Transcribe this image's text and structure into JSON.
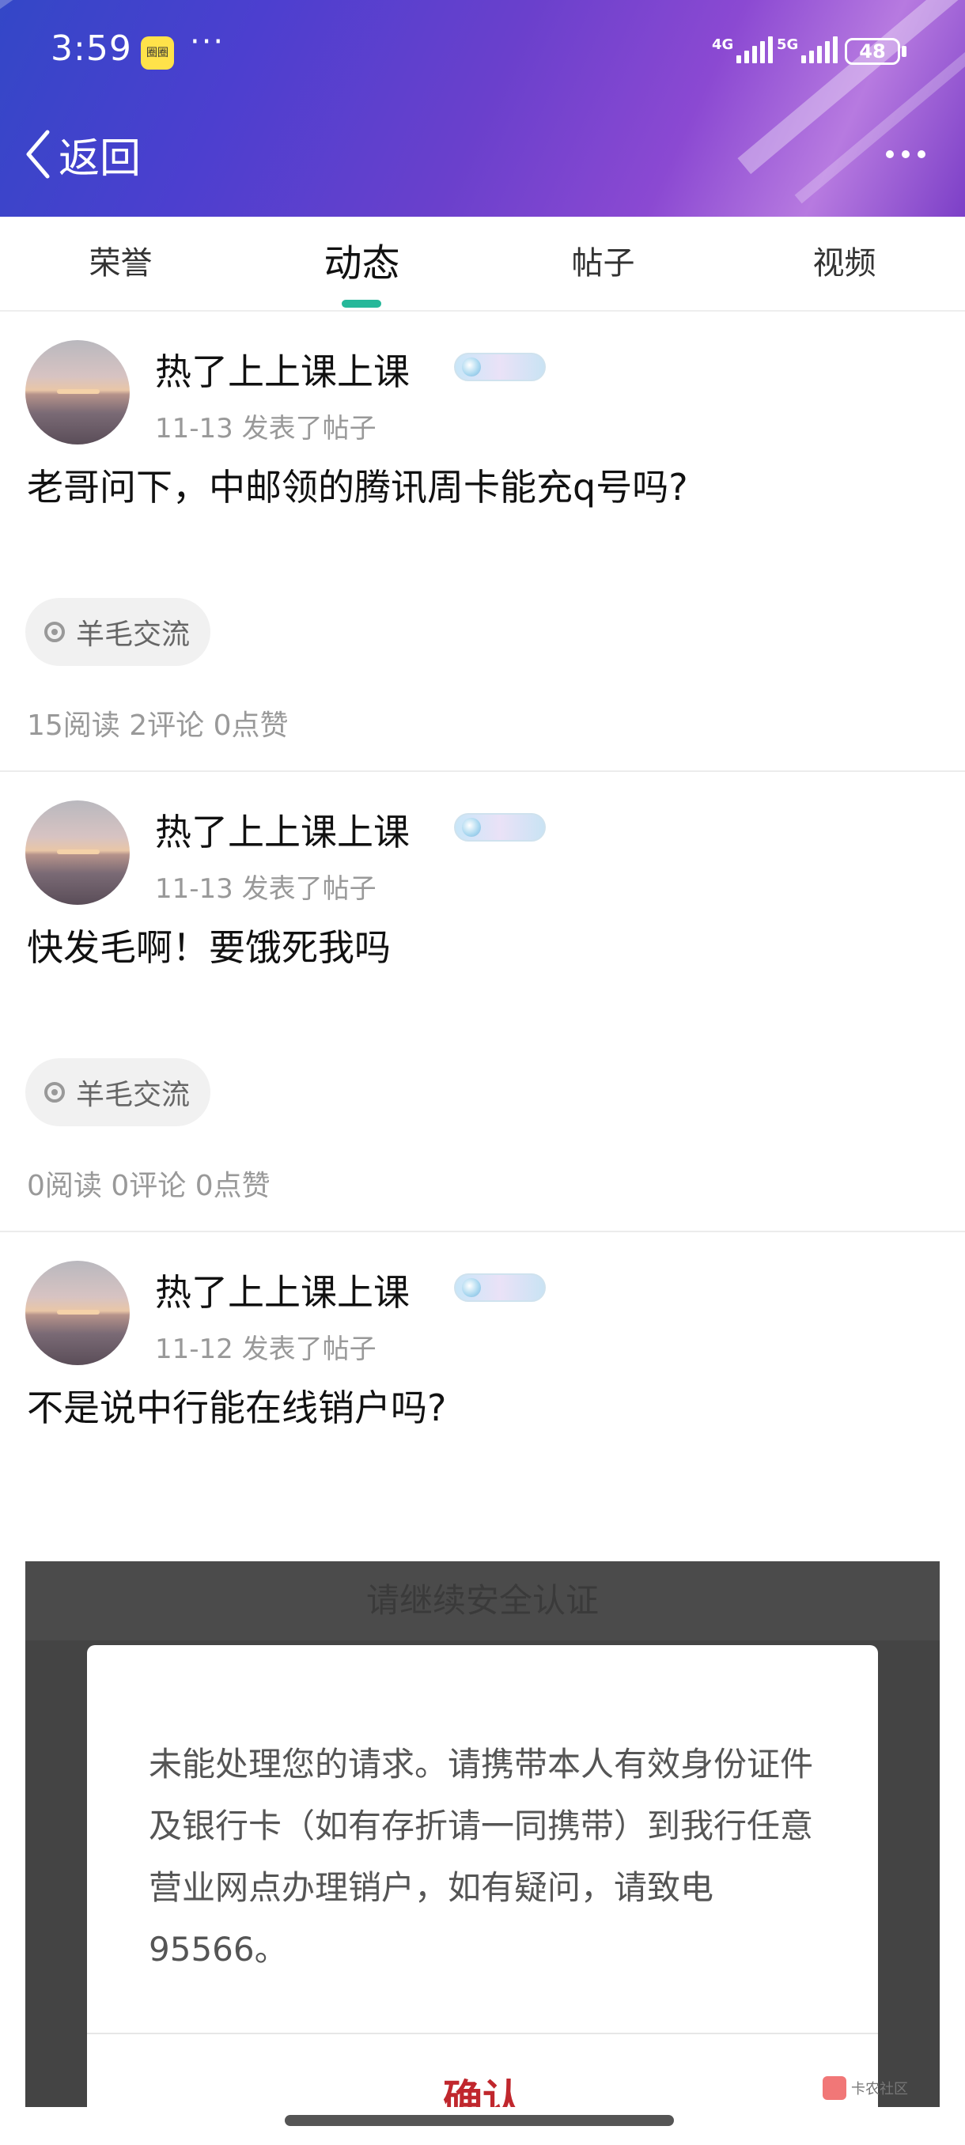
{
  "status_bar": {
    "time": "3:59",
    "app_icon_label": "圈圈",
    "more_label": "···",
    "network_1": "4G",
    "network_2": "5G",
    "battery": "48"
  },
  "nav": {
    "back_label": "返回"
  },
  "tabs": [
    {
      "label": "荣誉",
      "active": false
    },
    {
      "label": "动态",
      "active": true
    },
    {
      "label": "帖子",
      "active": false
    },
    {
      "label": "视频",
      "active": false
    }
  ],
  "accent_color": "#26b89a",
  "posts": [
    {
      "author": "热了上上课上课",
      "date": "11-13",
      "action": "发表了帖子",
      "body": "老哥问下，中邮领的腾讯周卡能充q号吗?",
      "topic": "羊毛交流",
      "reads": "15阅读",
      "comments": "2评论",
      "likes": "0点赞"
    },
    {
      "author": "热了上上课上课",
      "date": "11-13",
      "action": "发表了帖子",
      "body": "快发毛啊！要饿死我吗",
      "topic": "羊毛交流",
      "reads": "0阅读",
      "comments": "0评论",
      "likes": "0点赞"
    },
    {
      "author": "热了上上课上课",
      "date": "11-12",
      "action": "发表了帖子",
      "body": "不是说中行能在线销户吗?"
    }
  ],
  "embedded_screenshot": {
    "title": "请继续安全认证",
    "message": "未能处理您的请求。请携带本人有效身份证件及银行卡（如有存折请一同携带）到我行任意营业网点办理销户，如有疑问，请致电95566。",
    "confirm_label": "确认",
    "confirm_color": "#c0272d"
  },
  "watermark": "卡农社区"
}
